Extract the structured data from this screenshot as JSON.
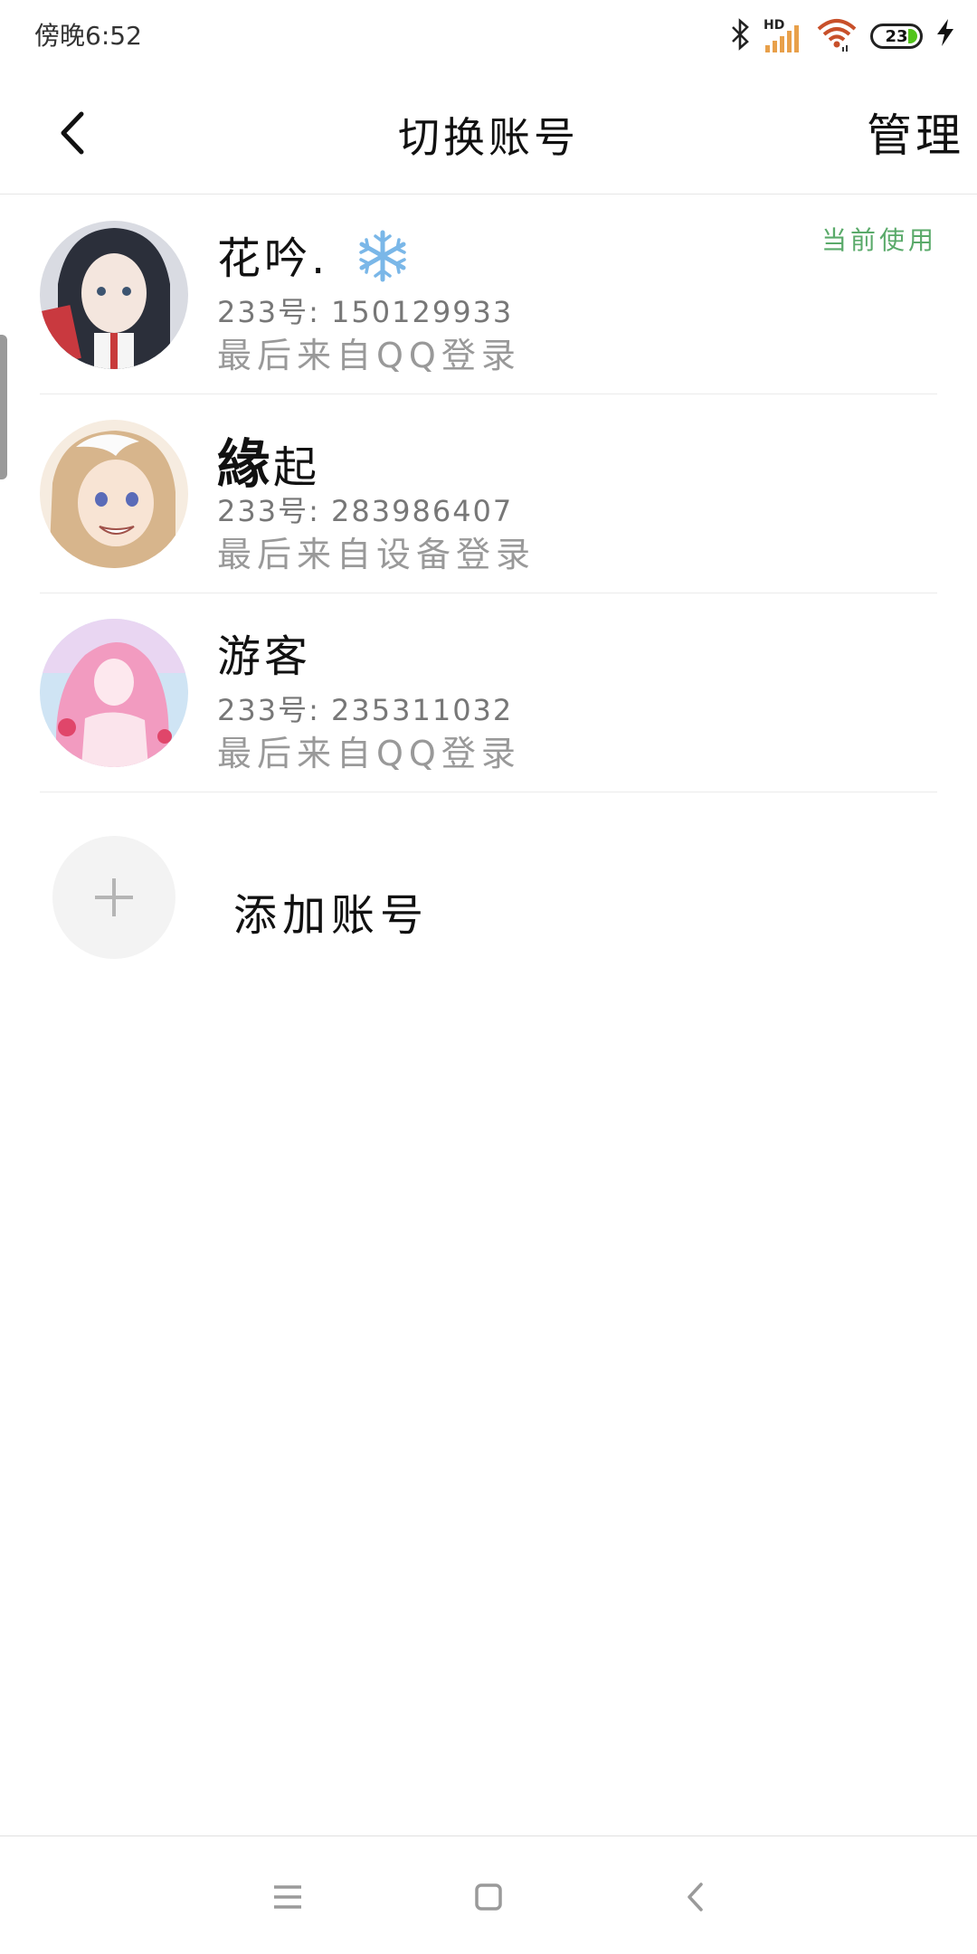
{
  "status_bar": {
    "time": "傍晚6:52",
    "network_label": "HD",
    "battery": "23"
  },
  "header": {
    "title": "切换账号",
    "manage_label": "管理"
  },
  "accounts": [
    {
      "name": "花吟.",
      "emoji": "snowflake-icon",
      "id_text": "233号: 150129933",
      "login_text": "最后来自QQ登录",
      "badge": "当前使用"
    },
    {
      "name_bold": "緣",
      "name_rest": "起",
      "id_text": "233号: 283986407",
      "login_text": "最后来自设备登录"
    },
    {
      "name": "游客",
      "id_text": "233号: 235311032",
      "login_text": "最后来自QQ登录"
    }
  ],
  "add_account": {
    "label": "添加账号"
  },
  "colors": {
    "current_badge": "#5aaa6a",
    "divider": "#ebebeb",
    "secondary_text": "#999999"
  }
}
